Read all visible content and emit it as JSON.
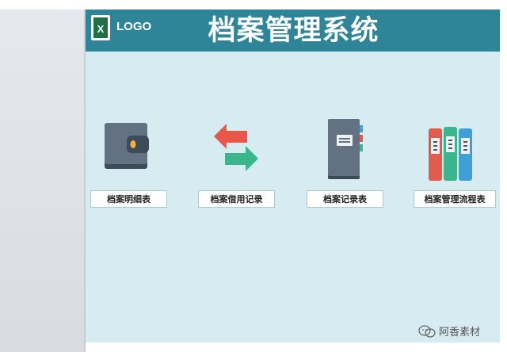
{
  "header": {
    "logo_text": "LOGO",
    "title": "档案管理系统"
  },
  "menu": {
    "items": [
      {
        "label": "档案明细表",
        "icon": "wallet-icon"
      },
      {
        "label": "档案借用记录",
        "icon": "transfer-arrows-icon"
      },
      {
        "label": "档案记录表",
        "icon": "notebook-icon"
      },
      {
        "label": "档案管理流程表",
        "icon": "binders-icon"
      }
    ]
  },
  "watermark": {
    "text": "阿香素材"
  },
  "colors": {
    "header_bg": "#2f8598",
    "main_bg": "#d6ecf1",
    "side_panel": "#e0e3e7"
  }
}
